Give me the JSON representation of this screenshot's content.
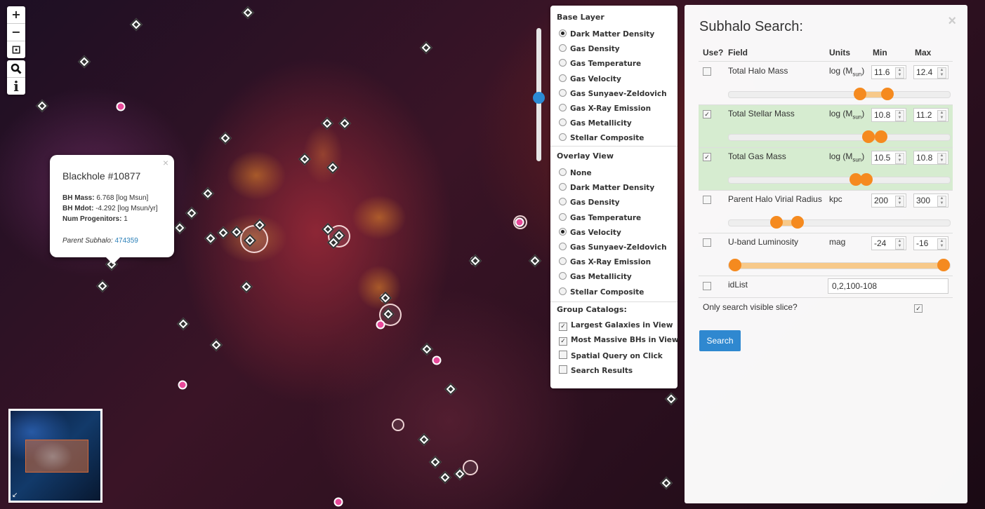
{
  "map": {
    "zoom_in": "+",
    "zoom_out": "−",
    "fit": "⊡",
    "search_tool": "🔍",
    "info_tool": "i"
  },
  "popup": {
    "title": "Blackhole #10877",
    "close": "×",
    "bh_mass_label": "BH Mass:",
    "bh_mass_value": " 6.768 [log Msun]",
    "bh_mdot_label": "BH Mdot:",
    "bh_mdot_value": " -4.292 [log Msun/yr]",
    "num_prog_label": "Num Progenitors:",
    "num_prog_value": " 1",
    "parent_label": "Parent Subhalo:",
    "parent_link": "474359"
  },
  "layers": {
    "base_heading": "Base Layer",
    "base_options": [
      {
        "label": "Dark Matter Density",
        "checked": true
      },
      {
        "label": "Gas Density",
        "checked": false
      },
      {
        "label": "Gas Temperature",
        "checked": false
      },
      {
        "label": "Gas Velocity",
        "checked": false
      },
      {
        "label": "Gas Sunyaev-Zeldovich",
        "checked": false
      },
      {
        "label": "Gas X-Ray Emission",
        "checked": false
      },
      {
        "label": "Gas Metallicity",
        "checked": false
      },
      {
        "label": "Stellar Composite",
        "checked": false
      }
    ],
    "overlay_heading": "Overlay View",
    "overlay_options": [
      {
        "label": "None",
        "checked": false
      },
      {
        "label": "Dark Matter Density",
        "checked": false
      },
      {
        "label": "Gas Density",
        "checked": false
      },
      {
        "label": "Gas Temperature",
        "checked": false
      },
      {
        "label": "Gas Velocity",
        "checked": true
      },
      {
        "label": "Gas Sunyaev-Zeldovich",
        "checked": false
      },
      {
        "label": "Gas X-Ray Emission",
        "checked": false
      },
      {
        "label": "Gas Metallicity",
        "checked": false
      },
      {
        "label": "Stellar Composite",
        "checked": false
      }
    ],
    "catalog_heading": "Group Catalogs:",
    "catalog_options": [
      {
        "label": "Largest Galaxies in View",
        "checked": true
      },
      {
        "label": "Most Massive BHs in View",
        "checked": true
      },
      {
        "label": "Spatial Query on Click",
        "checked": false
      },
      {
        "label": "Search Results",
        "checked": false
      }
    ]
  },
  "search": {
    "title": "Subhalo Search:",
    "close": "×",
    "headers": {
      "use": "Use?",
      "field": "Field",
      "units": "Units",
      "min": "Min",
      "max": "Max"
    },
    "rows": [
      {
        "field": "Total Halo Mass",
        "units_prefix": "log (M",
        "units_sub": "sun",
        "units_suffix": ")",
        "min": "11.6",
        "max": "12.4",
        "use": false,
        "range": [
          0.6,
          0.73
        ]
      },
      {
        "field": "Total Stellar Mass",
        "units_prefix": "log (M",
        "units_sub": "sun",
        "units_suffix": ")",
        "min": "10.8",
        "max": "11.2",
        "use": true,
        "range": [
          0.64,
          0.7
        ]
      },
      {
        "field": "Total Gas Mass",
        "units_prefix": "log (M",
        "units_sub": "sun",
        "units_suffix": ")",
        "min": "10.5",
        "max": "10.8",
        "use": true,
        "range": [
          0.58,
          0.63
        ]
      },
      {
        "field": "Parent Halo Virial Radius",
        "units_prefix": "kpc",
        "units_sub": "",
        "units_suffix": "",
        "min": "200",
        "max": "300",
        "use": false,
        "range": [
          0.2,
          0.3
        ]
      },
      {
        "field": "U-band Luminosity",
        "units_prefix": "mag",
        "units_sub": "",
        "units_suffix": "",
        "min": "-24",
        "max": "-16",
        "use": false,
        "range": [
          0.0,
          1.0
        ]
      }
    ],
    "idlist_label": "idList",
    "idlist_value": "0,2,100-108",
    "only_visible_label": "Only search visible slice?",
    "only_visible_checked": true,
    "search_button": "Search"
  },
  "minimap": {
    "expand_icon": "↙"
  }
}
